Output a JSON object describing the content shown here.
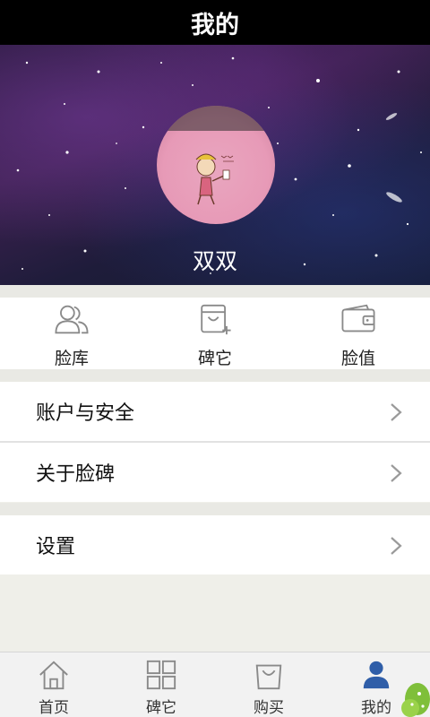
{
  "header": {
    "title": "我的"
  },
  "profile": {
    "username": "双双"
  },
  "quick_actions": [
    {
      "label": "脸库",
      "icon": "people-icon"
    },
    {
      "label": "碑它",
      "icon": "add-box-icon"
    },
    {
      "label": "脸值",
      "icon": "wallet-icon"
    }
  ],
  "menu": {
    "account_security": "账户与安全",
    "about": "关于脸碑",
    "settings": "设置"
  },
  "tabbar": [
    {
      "label": "首页",
      "icon": "home-icon"
    },
    {
      "label": "碑它",
      "icon": "grid-icon"
    },
    {
      "label": "购买",
      "icon": "shopping-bag-icon"
    },
    {
      "label": "我的",
      "icon": "person-icon",
      "active": true
    }
  ],
  "colors": {
    "accent": "#2f5ea8",
    "header_bg": "#000000",
    "icon_gray": "#8a8a8a"
  }
}
